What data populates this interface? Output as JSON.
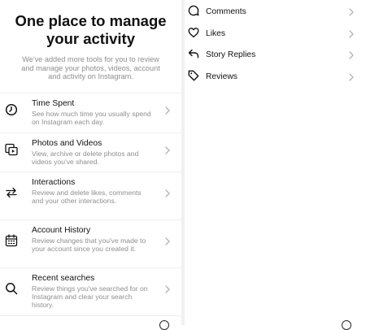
{
  "activity_overview": {
    "headline": "One place to manage your activity",
    "intro": "We've added more tools for you to review and manage your photos, videos, account and activity on Instagram.",
    "items": [
      {
        "title": "Time Spent",
        "description": "See how much time you usually spend on Instagram each day.",
        "icon": "clock-icon"
      },
      {
        "title": "Photos and Videos",
        "description": "View, archive or delete photos and videos you've shared.",
        "icon": "photos-videos-icon"
      },
      {
        "title": "Interactions",
        "description": "Review and delete likes, comments and your other interactions.",
        "icon": "interactions-arrows-icon"
      },
      {
        "title": "Account History",
        "description": "Review changes that you've made to your account since you created it.",
        "icon": "calendar-icon"
      },
      {
        "title": "Recent searches",
        "description": "Review things you've searched for on Instagram and clear your search history.",
        "icon": "search-icon"
      }
    ]
  },
  "interactions": {
    "items": [
      {
        "label": "Comments",
        "icon": "comment-bubble-icon"
      },
      {
        "label": "Likes",
        "icon": "heart-icon"
      },
      {
        "label": "Story Replies",
        "icon": "reply-arrow-icon"
      },
      {
        "label": "Reviews",
        "icon": "tag-icon"
      }
    ]
  },
  "colors": {
    "primary_text": "#111111",
    "secondary_text": "#8e8e8e",
    "divider": "#efefef",
    "chevron": "#b3b3b3"
  }
}
